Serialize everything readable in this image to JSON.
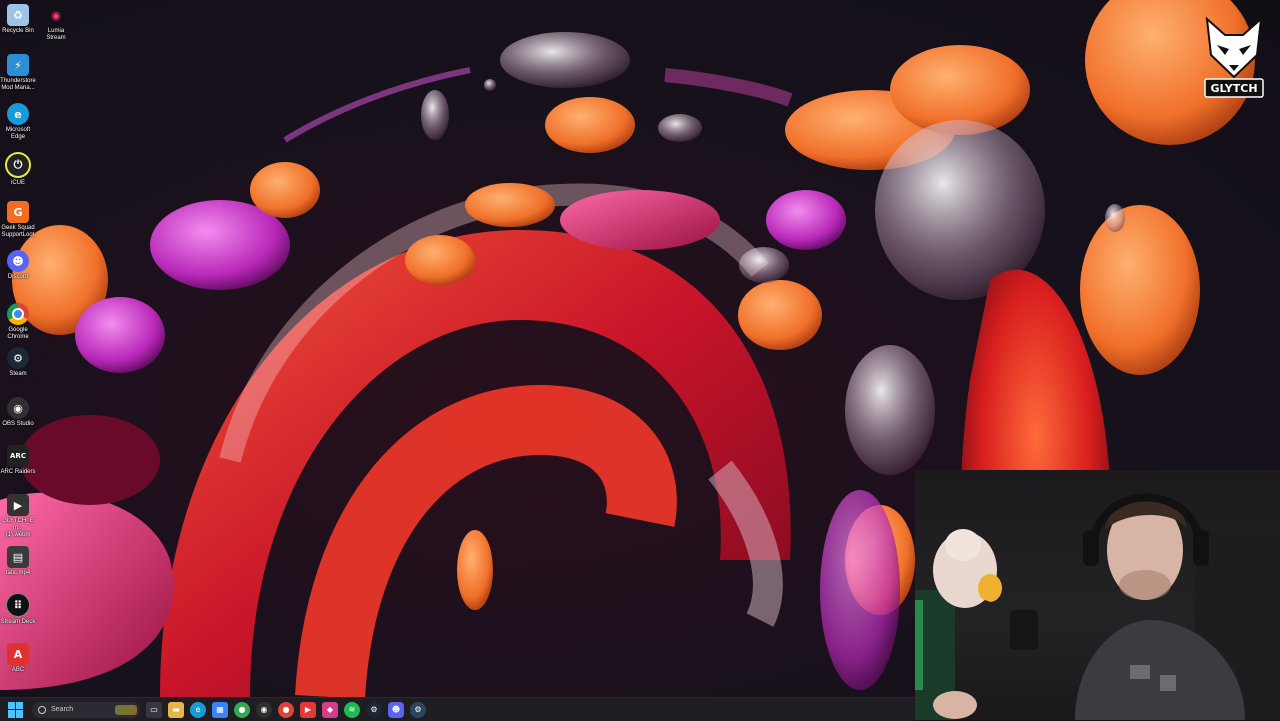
{
  "desktop": {
    "icons": [
      {
        "label": "Recycle Bin",
        "icon": "recycle-bin-icon",
        "color": "#9fc3e6"
      },
      {
        "label": "Lumia Stream",
        "icon": "lumia-stream-icon",
        "color": "#ff3b6b"
      },
      {
        "label": "Thunderstore Mod Mana...",
        "icon": "thunderstore-icon",
        "color": "#2c8fd6"
      },
      {
        "label": "Microsoft Edge",
        "icon": "edge-icon",
        "color": "#1a9bd7"
      },
      {
        "label": "iCUE",
        "icon": "icue-icon",
        "color": "#e8e84a"
      },
      {
        "label": "Geek Squad SupportLoot",
        "icon": "geek-squad-icon",
        "color": "#f26d21"
      },
      {
        "label": "Discord",
        "icon": "discord-icon",
        "color": "#5865f2"
      },
      {
        "label": "Google Chrome",
        "icon": "chrome-icon",
        "color": "#34a853"
      },
      {
        "label": "Steam",
        "icon": "steam-icon",
        "color": "#1b2838"
      },
      {
        "label": "OBS Studio",
        "icon": "obs-icon",
        "color": "#302e31"
      },
      {
        "label": "ARC Raiders",
        "icon": "arc-raiders-icon",
        "color": "#222222"
      },
      {
        "label": "GLYTCH_Em... (1).webm",
        "icon": "video-file-icon",
        "color": "#333333"
      },
      {
        "label": "tatic.mp4",
        "icon": "video-file-icon",
        "color": "#3a3a3a"
      },
      {
        "label": "Stream Deck",
        "icon": "stream-deck-icon",
        "color": "#111111"
      },
      {
        "label": "ABC",
        "icon": "app-a-icon",
        "color": "#e03131"
      }
    ]
  },
  "overlay": {
    "brand": "GLYTCH",
    "logo_icon": "fox-logo-icon"
  },
  "taskbar": {
    "search_placeholder": "Search",
    "start_icon": "windows-start-icon",
    "apps": [
      {
        "name": "task-view-icon",
        "glyph": "▭",
        "color": "#3a3640"
      },
      {
        "name": "file-explorer-icon",
        "glyph": "▬",
        "color": "#e8b54a"
      },
      {
        "name": "edge-icon",
        "glyph": "e",
        "color": "#1a9bd7"
      },
      {
        "name": "store-icon",
        "glyph": "▦",
        "color": "#3a82f7"
      },
      {
        "name": "chrome-icon",
        "glyph": "●",
        "color": "#34a853"
      },
      {
        "name": "obs-icon",
        "glyph": "◉",
        "color": "#302e31"
      },
      {
        "name": "chrome-icon",
        "glyph": "●",
        "color": "#db4437"
      },
      {
        "name": "app-red-icon",
        "glyph": "▶",
        "color": "#e53935"
      },
      {
        "name": "app-pink-icon",
        "glyph": "◆",
        "color": "#d43c8c"
      },
      {
        "name": "spotify-icon",
        "glyph": "≋",
        "color": "#1db954"
      },
      {
        "name": "steam-icon",
        "glyph": "⚙",
        "color": "#1b2838"
      },
      {
        "name": "discord-icon",
        "glyph": "☻",
        "color": "#5865f2"
      },
      {
        "name": "steam-icon",
        "glyph": "⚙",
        "color": "#2a475e"
      }
    ]
  }
}
